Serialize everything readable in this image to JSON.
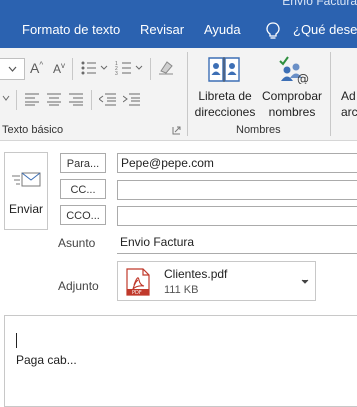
{
  "window": {
    "title": "Envío Factura"
  },
  "ribbon_tabs": [
    "Formato de texto",
    "Revisar",
    "Ayuda",
    "¿Qué desea"
  ],
  "ribbon": {
    "group_basic_text": "Texto básico",
    "group_names": "Nombres",
    "address_book": {
      "line1": "Libreta de",
      "line2": "direcciones"
    },
    "check_names": {
      "line1": "Comprobar",
      "line2": "nombres"
    },
    "attach_partial": {
      "line1": "Ad",
      "line2": "arc"
    }
  },
  "compose": {
    "send_label": "Enviar",
    "to_button": "Para...",
    "cc_button": "CC...",
    "bcc_button": "CCO...",
    "to_value": "Pepe@pepe.com",
    "cc_value": "",
    "bcc_value": "",
    "subject_label": "Asunto",
    "subject_value": "Envio Factura",
    "attachment_label": "Adjunto",
    "attachment": {
      "name": "Clientes.pdf",
      "size": "111 KB",
      "icon_text": "PDF"
    },
    "body_text": "Paga cab..."
  }
}
